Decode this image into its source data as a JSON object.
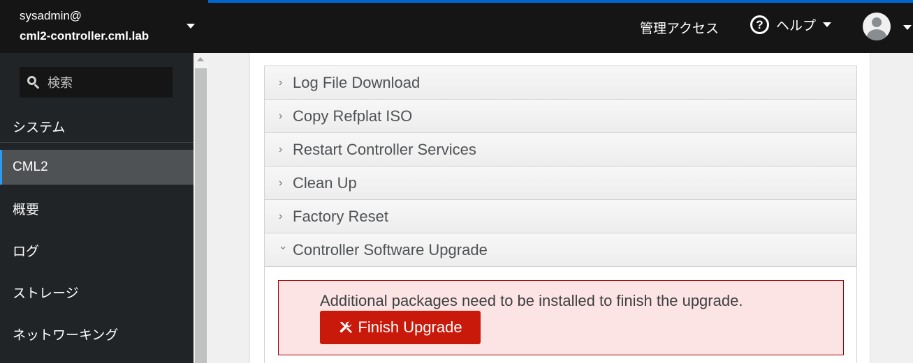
{
  "host": {
    "user": "sysadmin@",
    "name": "cml2-controller.cml.lab"
  },
  "search": {
    "placeholder": "検索"
  },
  "nav": {
    "items": [
      {
        "label": "システム"
      },
      {
        "label": "CML2"
      },
      {
        "label": "概要"
      },
      {
        "label": "ログ"
      },
      {
        "label": "ストレージ"
      },
      {
        "label": "ネットワーキング"
      }
    ]
  },
  "header": {
    "admin_access": "管理アクセス",
    "help": "ヘルプ"
  },
  "accordion": {
    "items": [
      {
        "label": "Log File Download",
        "expanded": false
      },
      {
        "label": "Copy Refplat ISO",
        "expanded": false
      },
      {
        "label": "Restart Controller Services",
        "expanded": false
      },
      {
        "label": "Clean Up",
        "expanded": false
      },
      {
        "label": "Factory Reset",
        "expanded": false
      },
      {
        "label": "Controller Software Upgrade",
        "expanded": true
      }
    ]
  },
  "upgrade": {
    "message": "Additional packages need to be installed to finish the upgrade.",
    "button_label": "Finish Upgrade"
  },
  "colors": {
    "accent": "#0066cc",
    "danger": "#c9190b",
    "sidebar": "#212427",
    "active_nav": "#4f5255"
  },
  "icons": [
    "search-icon",
    "help-icon",
    "avatar-icon",
    "wrench-icon",
    "chevron-right-icon",
    "chevron-down-icon"
  ]
}
